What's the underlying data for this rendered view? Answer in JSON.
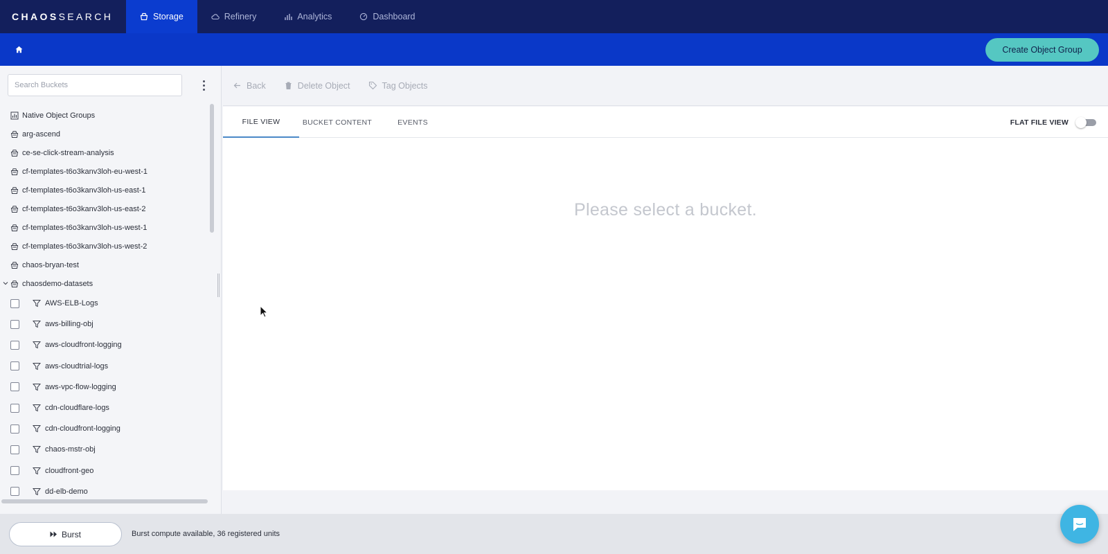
{
  "brand": {
    "name_bold": "CHAOS",
    "name_thin": "SEARCH"
  },
  "nav": {
    "tabs": [
      {
        "label": "Storage",
        "icon": "bucket-icon",
        "active": true
      },
      {
        "label": "Refinery",
        "icon": "cloud-icon",
        "active": false
      },
      {
        "label": "Analytics",
        "icon": "bar-chart-icon",
        "active": false
      },
      {
        "label": "Dashboard",
        "icon": "dashboard-icon",
        "active": false
      }
    ]
  },
  "subbar": {
    "create_label": "Create Object Group"
  },
  "sidebar": {
    "search_placeholder": "Search Buckets",
    "tree": [
      {
        "label": "Native Object Groups",
        "icon": "chart-icon"
      },
      {
        "label": "arg-ascend",
        "icon": "bucket-icon"
      },
      {
        "label": "ce-se-click-stream-analysis",
        "icon": "bucket-icon"
      },
      {
        "label": "cf-templates-t6o3kanv3loh-eu-west-1",
        "icon": "bucket-icon"
      },
      {
        "label": "cf-templates-t6o3kanv3loh-us-east-1",
        "icon": "bucket-icon"
      },
      {
        "label": "cf-templates-t6o3kanv3loh-us-east-2",
        "icon": "bucket-icon"
      },
      {
        "label": "cf-templates-t6o3kanv3loh-us-west-1",
        "icon": "bucket-icon"
      },
      {
        "label": "cf-templates-t6o3kanv3loh-us-west-2",
        "icon": "bucket-icon"
      },
      {
        "label": "chaos-bryan-test",
        "icon": "bucket-icon"
      },
      {
        "label": "chaosdemo-datasets",
        "icon": "bucket-icon",
        "expanded": true
      }
    ],
    "children": [
      "AWS-ELB-Logs",
      "aws-billing-obj",
      "aws-cloudfront-logging",
      "aws-cloudtrial-logs",
      "aws-vpc-flow-logging",
      "cdn-cloudflare-logs",
      "cdn-cloudfront-logging",
      "chaos-mstr-obj",
      "cloudfront-geo",
      "dd-elb-demo"
    ]
  },
  "toolbar": {
    "back_label": "Back",
    "delete_label": "Delete Object",
    "tag_label": "Tag Objects"
  },
  "panel": {
    "tabs": [
      "FILE VIEW",
      "BUCKET CONTENT",
      "EVENTS"
    ],
    "active_tab": "FILE VIEW",
    "flat_file_label": "FLAT FILE VIEW",
    "flat_file_enabled": false,
    "empty_message": "Please select a bucket."
  },
  "bottombar": {
    "burst_label": "Burst",
    "burst_status": "Burst compute available, 36 registered units"
  },
  "colors": {
    "topnav": "#131f5c",
    "subbar": "#0a38c8",
    "accent_teal": "#55c7c2",
    "chat": "#3fb5e3",
    "tab_underline": "#4a88c7"
  }
}
